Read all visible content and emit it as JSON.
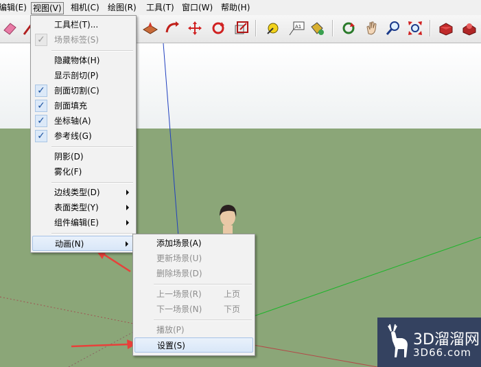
{
  "menubar": {
    "items": [
      {
        "label": "编辑(E)"
      },
      {
        "label": "视图(V)"
      },
      {
        "label": "相机(C)"
      },
      {
        "label": "绘图(R)"
      },
      {
        "label": "工具(T)"
      },
      {
        "label": "窗口(W)"
      },
      {
        "label": "帮助(H)"
      }
    ]
  },
  "view_menu": {
    "items": [
      {
        "label": "工具栏(T)...",
        "checked": false,
        "disabled": false,
        "submenu": false
      },
      {
        "label": "场景标签(S)",
        "checked": true,
        "disabled": true,
        "submenu": false
      },
      {
        "label": "隐藏物体(H)",
        "checked": false,
        "disabled": false,
        "submenu": false
      },
      {
        "label": "显示剖切(P)",
        "checked": false,
        "disabled": false,
        "submenu": false
      },
      {
        "label": "剖面切割(C)",
        "checked": true,
        "disabled": false,
        "submenu": false
      },
      {
        "label": "剖面填充",
        "checked": true,
        "disabled": false,
        "submenu": false
      },
      {
        "label": "坐标轴(A)",
        "checked": true,
        "disabled": false,
        "submenu": false
      },
      {
        "label": "参考线(G)",
        "checked": true,
        "disabled": false,
        "submenu": false
      },
      {
        "label": "阴影(D)",
        "checked": false,
        "disabled": false,
        "submenu": false
      },
      {
        "label": "雾化(F)",
        "checked": false,
        "disabled": false,
        "submenu": false
      },
      {
        "label": "边线类型(D)",
        "checked": false,
        "disabled": false,
        "submenu": true
      },
      {
        "label": "表面类型(Y)",
        "checked": false,
        "disabled": false,
        "submenu": true
      },
      {
        "label": "组件编辑(E)",
        "checked": false,
        "disabled": false,
        "submenu": true
      },
      {
        "label": "动画(N)",
        "checked": false,
        "disabled": false,
        "submenu": true,
        "highlighted": true
      }
    ]
  },
  "animation_submenu": {
    "items": [
      {
        "label": "添加场景(A)",
        "disabled": false
      },
      {
        "label": "更新场景(U)",
        "disabled": true
      },
      {
        "label": "删除场景(D)",
        "disabled": true
      },
      {
        "label": "上一场景(R)",
        "shortcut": "上页",
        "disabled": true
      },
      {
        "label": "下一场景(N)",
        "shortcut": "下页",
        "disabled": true
      },
      {
        "label": "播放(P)",
        "disabled": true
      },
      {
        "label": "设置(S)",
        "disabled": false,
        "highlighted": true
      }
    ]
  },
  "watermark": {
    "line1": "3D溜溜网",
    "line2": "3D66.com"
  },
  "colors": {
    "ground": "#8ba678",
    "axis_blue": "#1f3fbf",
    "axis_green": "#1db52a",
    "axis_red": "#b34848",
    "annotation_arrow": "#e8403a"
  }
}
